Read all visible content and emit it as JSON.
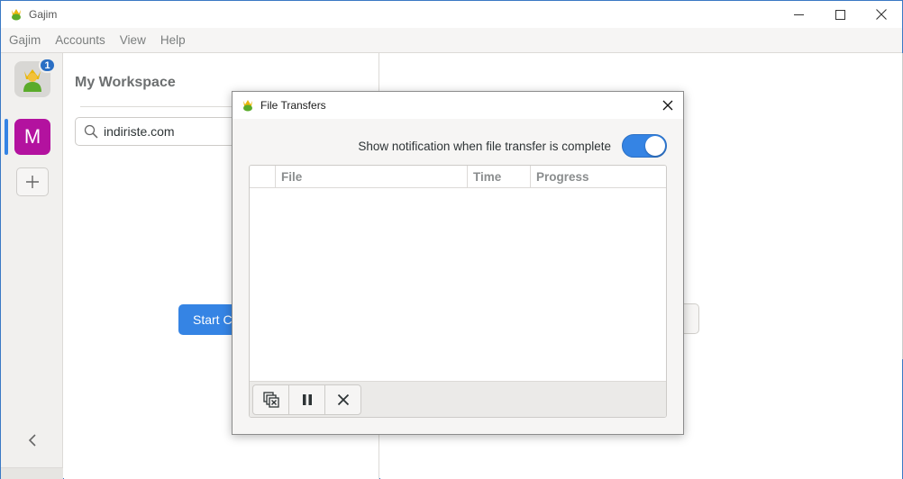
{
  "window": {
    "title": "Gajim",
    "controls": {
      "minimize_icon": "minimize-icon",
      "maximize_icon": "maximize-icon",
      "close_icon": "close-icon"
    }
  },
  "menubar": {
    "items": [
      {
        "label": "Gajim"
      },
      {
        "label": "Accounts"
      },
      {
        "label": "View"
      },
      {
        "label": "Help"
      }
    ]
  },
  "account_bar": {
    "self_avatar_icon": "user-avatar-icon",
    "badge_count": "1",
    "workspace_initial": "M",
    "workspace_color": "#b3129f",
    "add_workspace_icon": "plus-icon",
    "collapse_icon": "chevron-left-icon"
  },
  "chat_list": {
    "workspace_title": "My Workspace",
    "search": {
      "value": "indiriste.com",
      "icon": "search-icon"
    },
    "start_chat_label": "Start Ch"
  },
  "dialog": {
    "title": "File Transfers",
    "notification_label": "Show notification when file transfer is complete",
    "notification_enabled": true,
    "columns": [
      {
        "label": ""
      },
      {
        "label": "File"
      },
      {
        "label": "Time"
      },
      {
        "label": "Progress"
      }
    ],
    "rows": [],
    "toolbar": {
      "clean_icon": "clean-up-icon",
      "pause_icon": "pause-icon",
      "cancel_icon": "cancel-icon"
    }
  },
  "colors": {
    "accent": "#3584e4",
    "badge": "#2a6fc4",
    "window_border": "#3a79c4"
  }
}
